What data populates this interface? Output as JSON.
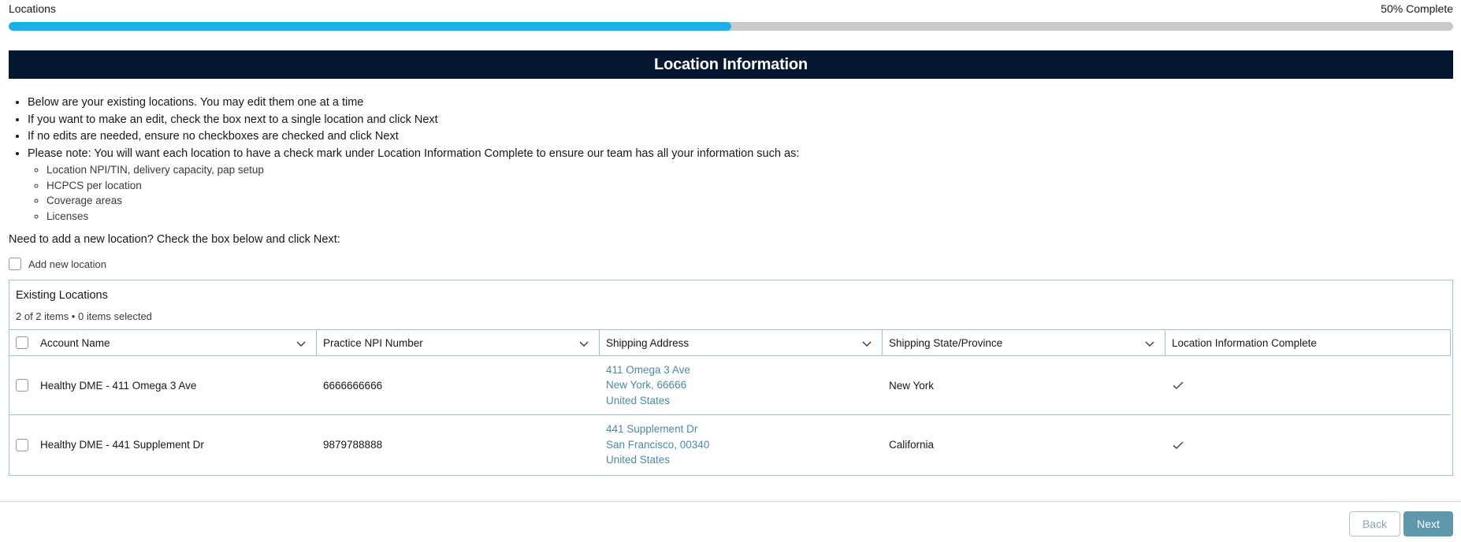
{
  "progress": {
    "label": "Locations",
    "status": "50% Complete",
    "fraction": 0.5,
    "fill_color": "#1ab0f0",
    "track_color": "#c9c9c9"
  },
  "section": {
    "title": "Location Information",
    "banner_color": "#03172f"
  },
  "instructions": {
    "items": [
      "Below are your existing locations. You may edit them one at a time",
      "If you want to make an edit, check the box next to a single location and click Next",
      "If no edits are needed, ensure no checkboxes are checked and click Next",
      "Please note: You will want each location to have a check mark under Location Information Complete to ensure our team has all your information such as:"
    ],
    "sub_items": [
      "Location NPI/TIN, delivery capacity, pap setup",
      "HCPCS per location",
      "Coverage areas",
      "Licenses"
    ]
  },
  "add_location": {
    "prompt": "Need to add a new location? Check the box below and click Next:",
    "checkbox_label": "Add new location",
    "checked": false
  },
  "table": {
    "title": "Existing Locations",
    "meta": "2 of 2 items • 0 items selected",
    "columns": [
      "Account Name",
      "Practice NPI Number",
      "Shipping Address",
      "Shipping State/Province",
      "Location Information Complete"
    ],
    "rows": [
      {
        "account": "Healthy DME - 411 Omega 3 Ave",
        "npi": "6666666666",
        "address": [
          "411 Omega 3 Ave",
          "New York, 66666",
          "United States"
        ],
        "state": "New York",
        "complete": true
      },
      {
        "account": "Healthy DME - 441 Supplement Dr",
        "npi": "9879788888",
        "address": [
          "441 Supplement Dr",
          "San Francisco, 00340",
          "United States"
        ],
        "state": "California",
        "complete": true
      }
    ]
  },
  "footer": {
    "back_label": "Back",
    "next_label": "Next"
  }
}
